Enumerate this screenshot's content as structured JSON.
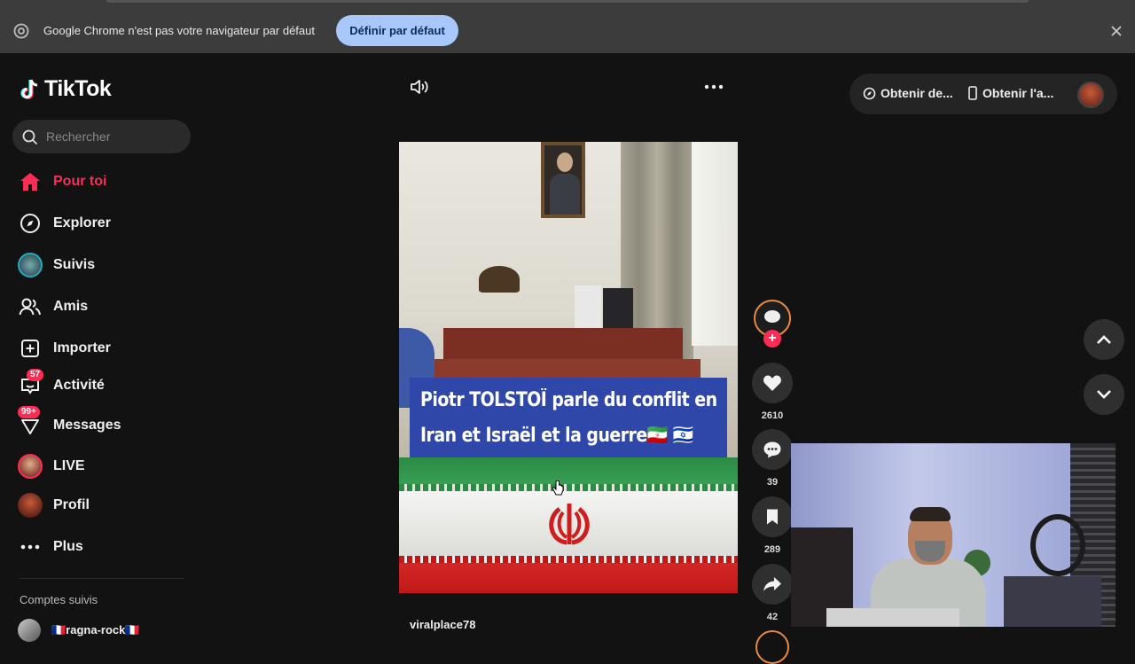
{
  "infobar": {
    "message": "Google Chrome n'est pas votre navigateur par défaut",
    "button_label": "Définir par défaut",
    "close_icon": "close-icon"
  },
  "brand": {
    "name": "TikTok"
  },
  "search": {
    "placeholder": "Rechercher"
  },
  "nav": {
    "items": [
      {
        "label": "Pour toi",
        "icon": "home-icon",
        "active": true
      },
      {
        "label": "Explorer",
        "icon": "compass-icon"
      },
      {
        "label": "Suivis",
        "icon": "avatar"
      },
      {
        "label": "Amis",
        "icon": "friends-icon"
      },
      {
        "label": "Importer",
        "icon": "upload-icon"
      },
      {
        "label": "Activité",
        "icon": "inbox-icon",
        "badge": "57"
      },
      {
        "label": "Messages",
        "icon": "messages-icon",
        "badge": "99+"
      },
      {
        "label": "LIVE",
        "icon": "live-avatar"
      },
      {
        "label": "Profil",
        "icon": "profile-avatar"
      },
      {
        "label": "Plus",
        "icon": "more-icon"
      }
    ]
  },
  "following": {
    "section_label": "Comptes suivis",
    "accounts": [
      {
        "name": "🇫🇷ragna-rock🇫🇷"
      }
    ]
  },
  "header": {
    "get_coins_label": "Obtenir de...",
    "get_app_label": "Obtenir l'a..."
  },
  "video": {
    "caption_line1": "Piotr TOLSTOÏ parle du conflit en",
    "caption_line2": "Iran et Israël et la guerre🇮🇷 🇮🇱",
    "username": "viralplace78"
  },
  "actions": {
    "likes": "2610",
    "comments": "39",
    "saves": "289",
    "shares": "42"
  },
  "colors": {
    "accent": "#fe2c55",
    "infobar_button": "#a8c7fa",
    "background": "#121212"
  }
}
